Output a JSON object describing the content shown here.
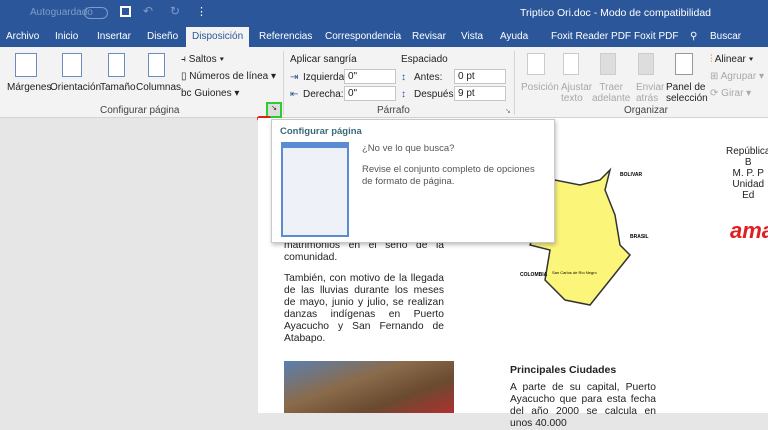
{
  "titlebar": {
    "autosave": "Autoguardado",
    "autosave_state": "off",
    "doc_title": "Triptico Ori.doc  -  Modo de compatibilidad"
  },
  "tabs": [
    {
      "label": "Archivo"
    },
    {
      "label": "Inicio"
    },
    {
      "label": "Insertar"
    },
    {
      "label": "Diseño"
    },
    {
      "label": "Disposición",
      "active": true
    },
    {
      "label": "Referencias"
    },
    {
      "label": "Correspondencia"
    },
    {
      "label": "Revisar"
    },
    {
      "label": "Vista"
    },
    {
      "label": "Ayuda"
    },
    {
      "label": "Foxit Reader PDF"
    },
    {
      "label": "Foxit PDF"
    }
  ],
  "search_label": "Buscar",
  "ribbon": {
    "page_setup": {
      "margenes": "Márgenes",
      "orientacion": "Orientación",
      "tamano": "Tamaño",
      "columnas": "Columnas",
      "saltos": "Saltos",
      "numeros": "Números de línea",
      "guiones": "Guiones",
      "group": "Configurar página"
    },
    "paragraph": {
      "sangria": "Aplicar sangría",
      "izq_label": "Izquierda:",
      "izq_value": "0\"",
      "der_label": "Derecha:",
      "der_value": "0\"",
      "espaciado": "Espaciado",
      "antes_label": "Antes:",
      "antes_value": "0 pt",
      "despues_label": "Después:",
      "despues_value": "9 pt",
      "group": "Párrafo"
    },
    "arrange": {
      "posicion": "Posición",
      "ajustar1": "Ajustar",
      "ajustar2": "texto",
      "traer1": "Traer",
      "traer2": "adelante",
      "enviar1": "Enviar",
      "enviar2": "atrás",
      "panel1": "Panel de",
      "panel2": "selección",
      "alinear": "Alinear",
      "agrupar": "Agrupar",
      "girar": "Girar",
      "group": "Organizar"
    }
  },
  "tooltip": {
    "title": "Configurar página",
    "question": "¿No ve lo que busca?",
    "description": "Revise el conjunto completo de opciones de formato de página."
  },
  "document": {
    "para1": "matrimonios en el seno de la comunidad.",
    "para2": "También, con motivo de la llegada de las lluvias durante los meses de mayo, junio y julio, se realizan danzas indígenas en Puerto Ayacucho y San Fernando de Atabapo.",
    "map_labels": {
      "bolivar": "BOLIVAR",
      "brasil": "BRASIL",
      "colombia": "COLOMBIA",
      "san_carlos": "San Carlos de Río Negro"
    },
    "right_header": [
      "República B",
      "M. P. P",
      "Unidad Ed"
    ],
    "logo_text": "ama",
    "heading": "Principales Ciudades",
    "para3": "A parte de su capital, Puerto Ayacucho que para esta fecha del año 2000 se calcula en unos 40.000"
  }
}
